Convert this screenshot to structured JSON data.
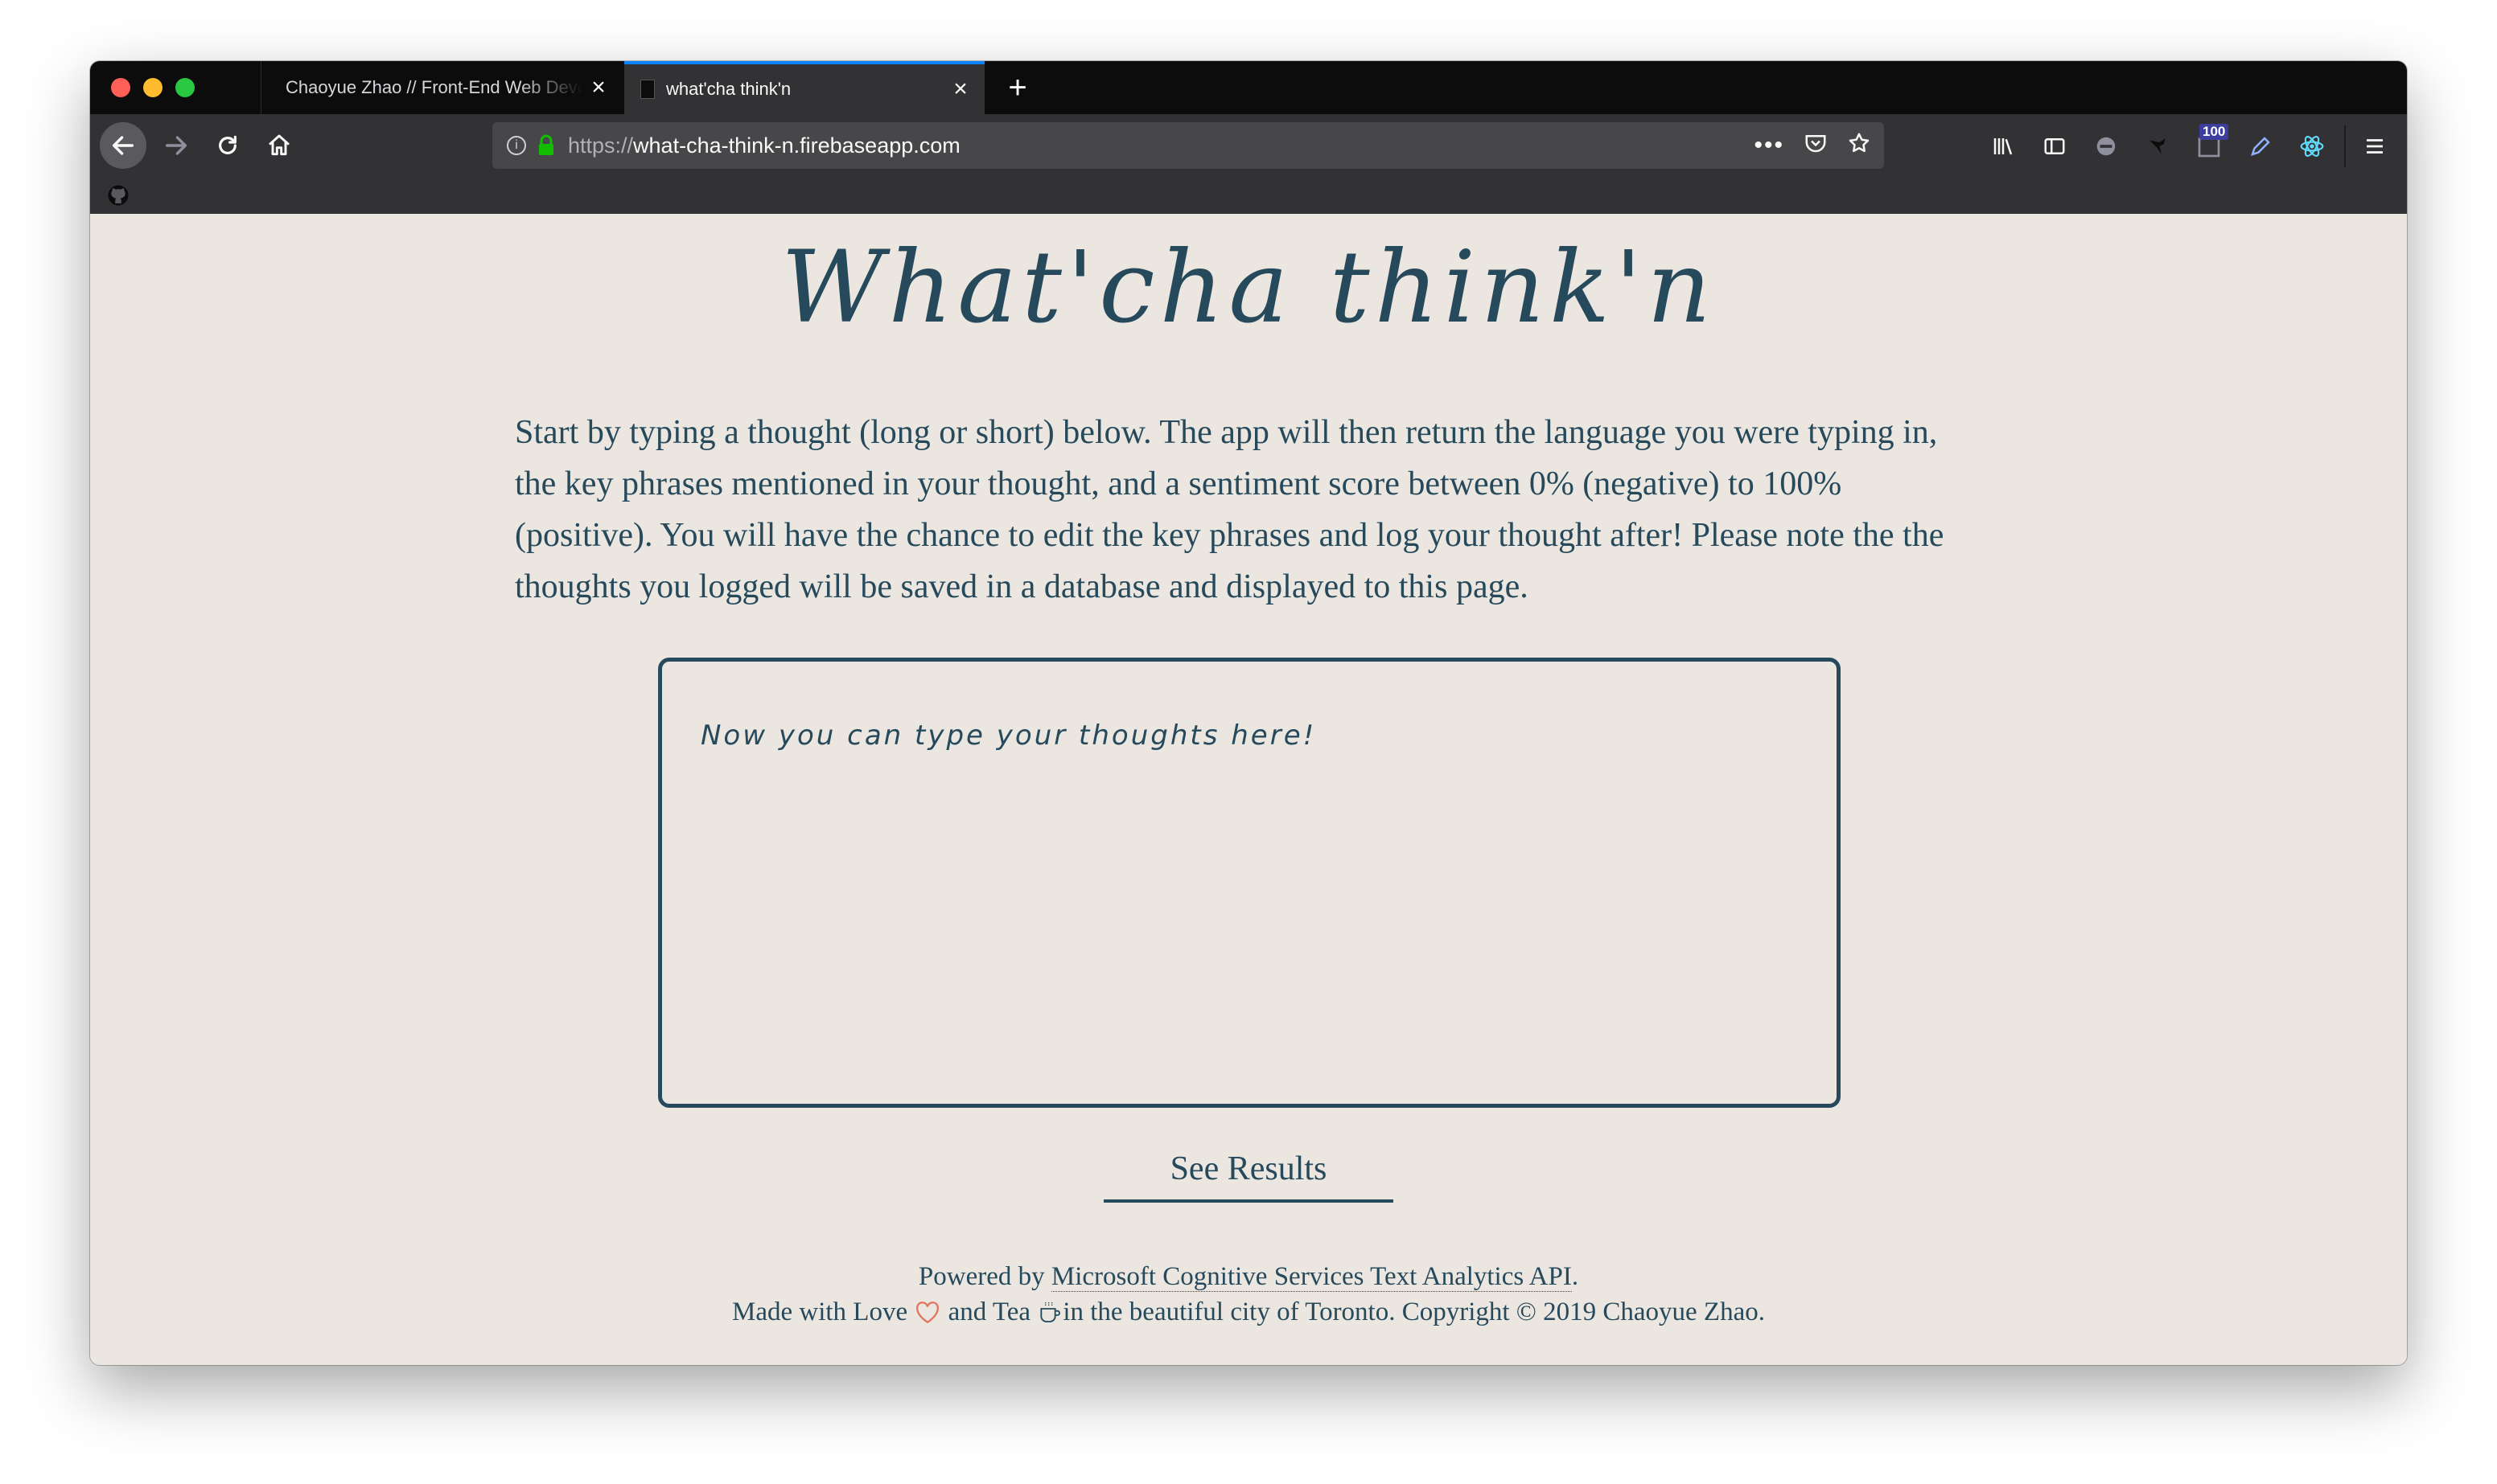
{
  "browser": {
    "tabs": [
      {
        "title": "Chaoyue Zhao // Front-End Web Developer"
      },
      {
        "title": "what'cha think'n",
        "active": true
      }
    ],
    "url_scheme": "https://",
    "url_host": "what-cha-think-n.firebaseapp.com",
    "badge_count": "100",
    "accent_color": "#0a84ff"
  },
  "page": {
    "title": "What'cha think'n",
    "intro": "Start by typing a thought (long or short) below. The app will then return the language you were typing in, the key phrases mentioned in your thought, and a sentiment score between 0% (negative) to 100% (positive). You will have the chance to edit the key phrases and log your thought after! Please note the the thoughts you logged will be saved in a database and displayed to this page.",
    "input_placeholder": "Now you can type your thoughts here!",
    "button_label": "See Results",
    "footer": {
      "powered_prefix": "Powered by",
      "api_link": "Microsoft Cognitive Services Text Analytics API",
      "powered_suffix": ".",
      "made_with": "Made with Love",
      "and_tea": "and Tea",
      "rest": "in the beautiful city of Toronto. Copyright © 2019 Chaoyue Zhao."
    },
    "text_color": "#26495c",
    "background_color": "#ebe6df"
  }
}
